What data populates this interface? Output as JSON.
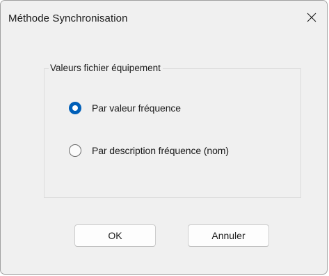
{
  "window": {
    "title": "Méthode Synchronisation",
    "close_icon": "close-icon"
  },
  "group": {
    "legend": "Valeurs fichier équipement",
    "options": [
      {
        "label": "Par valeur fréquence",
        "checked": true
      },
      {
        "label": "Par description fréquence (nom)",
        "checked": false
      }
    ]
  },
  "buttons": {
    "ok_label": "OK",
    "cancel_label": "Annuler"
  },
  "colors": {
    "accent": "#005fb8",
    "window_bg": "#f0f0f0"
  }
}
